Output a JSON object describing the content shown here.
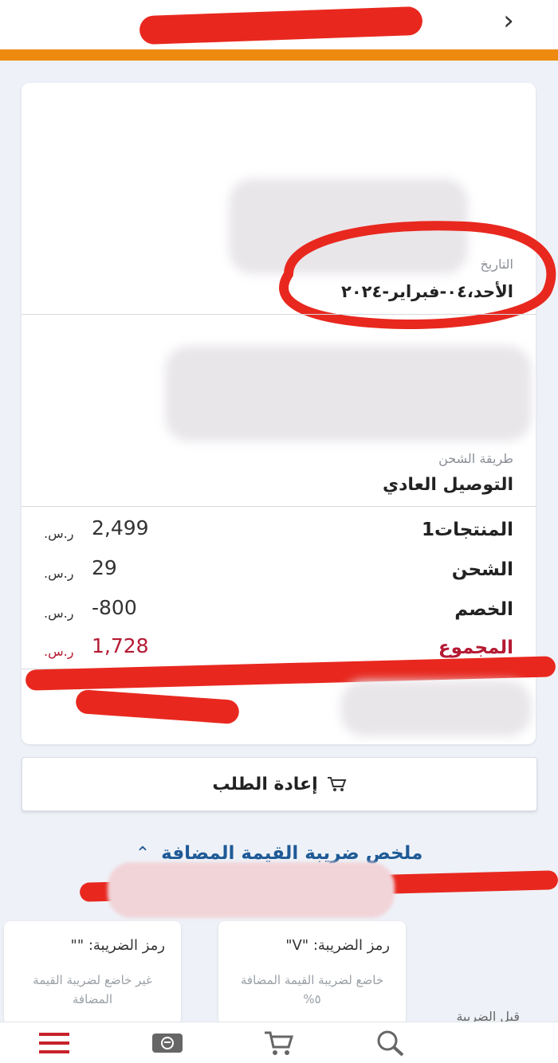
{
  "header": {
    "back_icon": "chevron-right-icon"
  },
  "order": {
    "date_label": "التاريخ",
    "date_value": "الأحد،٠٤-فبراير-٢٠٢٤",
    "shipping_method_label": "طريقة الشحن",
    "shipping_method_value": "التوصيل العادي"
  },
  "summary": {
    "currency": "ر.س.",
    "rows": [
      {
        "label": "المنتجات1",
        "amount": "2,499"
      },
      {
        "label": "الشحن",
        "amount": "29"
      },
      {
        "label": "الخصم",
        "amount": "-800"
      },
      {
        "label": "المجموع",
        "amount": "1,728"
      }
    ]
  },
  "reorder": {
    "label": "إعادة الطلب",
    "icon": "cart-icon"
  },
  "vat": {
    "title": "ملخص ضريبة القيمة المضافة",
    "toggle_icon": "chevron-up-icon",
    "cards": [
      {
        "code": "رمز الضريبة: \"V\"",
        "desc": "خاضع لضريبة القيمة المضافة ٥%"
      },
      {
        "code": "رمز الضريبة: \"\"",
        "desc": "غير خاضع لضريبة القيمة المضافة"
      }
    ],
    "side_label": "قبل الضريبة"
  },
  "nav": [
    "menu-icon",
    "card-icon",
    "cart-icon",
    "search-icon"
  ],
  "colors": {
    "accent": "#ee8a0f",
    "total": "#b51a33",
    "link": "#1f5a96"
  }
}
